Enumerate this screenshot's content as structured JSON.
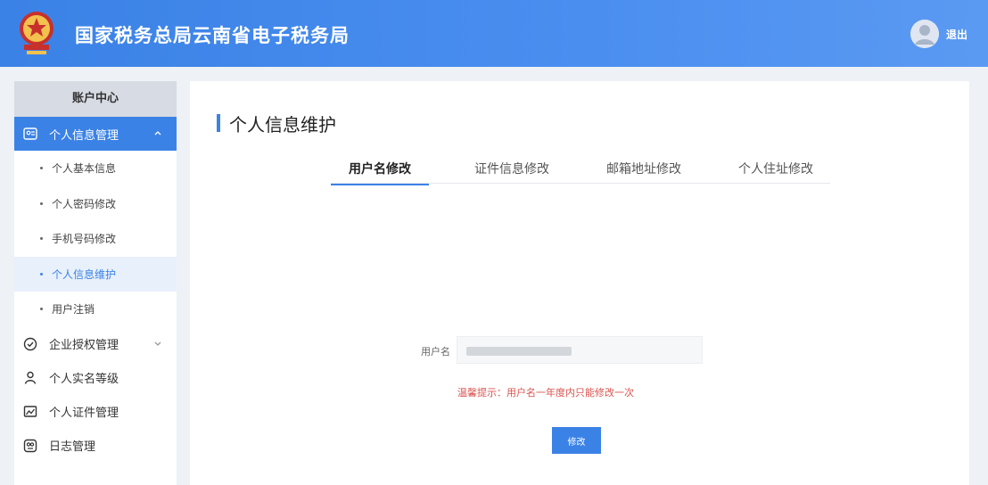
{
  "header": {
    "site_title": "国家税务总局云南省电子税务局",
    "logout_label": "退出"
  },
  "sidebar": {
    "title": "账户中心",
    "groups": [
      {
        "label": "个人信息管理",
        "icon": "id-card-icon",
        "expanded": true,
        "items": [
          {
            "label": "个人基本信息"
          },
          {
            "label": "个人密码修改"
          },
          {
            "label": "手机号码修改"
          },
          {
            "label": "个人信息维护",
            "current": true
          },
          {
            "label": "用户注销"
          }
        ]
      },
      {
        "label": "企业授权管理",
        "icon": "check-circle-icon"
      },
      {
        "label": "个人实名等级",
        "icon": "person-icon"
      },
      {
        "label": "个人证件管理",
        "icon": "certificate-icon"
      },
      {
        "label": "日志管理",
        "icon": "log-icon"
      }
    ]
  },
  "main": {
    "page_title": "个人信息维护",
    "tabs": [
      {
        "label": "用户名修改",
        "active": true
      },
      {
        "label": "证件信息修改"
      },
      {
        "label": "邮箱地址修改"
      },
      {
        "label": "个人住址修改"
      }
    ],
    "form": {
      "username_label": "用户名",
      "username_value": "",
      "hint": "温馨提示：用户名一年度内只能修改一次",
      "save_label": "修改"
    }
  },
  "colors": {
    "primary": "#3b82e6",
    "hint_red": "#d9534f",
    "sidebar_header_bg": "#d7dbe3",
    "page_bg": "#eef1f6"
  }
}
